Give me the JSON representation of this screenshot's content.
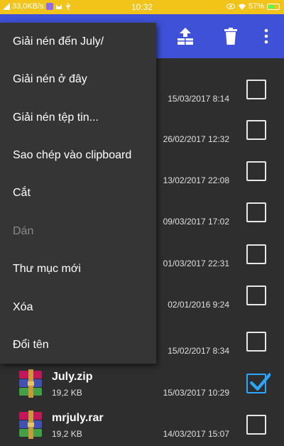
{
  "status_bar": {
    "speed": "33,0KB/s",
    "time": "10:32",
    "battery": "57%"
  },
  "menu": {
    "items": [
      {
        "label": "Giải nén đến July/",
        "enabled": true
      },
      {
        "label": "Giải nén ở đây",
        "enabled": true
      },
      {
        "label": "Giải nén tệp tin...",
        "enabled": true
      },
      {
        "label": "Sao chép vào clipboard",
        "enabled": true
      },
      {
        "label": "Cắt",
        "enabled": true
      },
      {
        "label": "Dán",
        "enabled": false
      },
      {
        "label": "Thư mục mới",
        "enabled": true
      },
      {
        "label": "Xóa",
        "enabled": true
      },
      {
        "label": "Đổi tên",
        "enabled": true
      }
    ]
  },
  "files": [
    {
      "name": "",
      "size": "",
      "date": "15/03/2017 8:14",
      "checked": false
    },
    {
      "name": "",
      "size": "",
      "date": "26/02/2017 12:32",
      "checked": false
    },
    {
      "name": "",
      "size": "",
      "date": "13/02/2017 22:08",
      "checked": false
    },
    {
      "name": "",
      "size": "",
      "date": "09/03/2017 17:02",
      "checked": false
    },
    {
      "name": "",
      "size": "",
      "date": "01/03/2017 22:31",
      "checked": false
    },
    {
      "name": "",
      "size": "",
      "date": "02/01/2016 9:24",
      "checked": false
    },
    {
      "name": "",
      "size": "",
      "date": "15/02/2017 8:34",
      "checked": false
    },
    {
      "name": "July.zip",
      "size": "19,2 KB",
      "date": "15/03/2017 10:29",
      "checked": true
    },
    {
      "name": "mrjuly.rar",
      "size": "19,2 KB",
      "date": "14/03/2017 15:07",
      "checked": false
    }
  ],
  "colors": {
    "status_bar": "#f2c318",
    "app_bar": "#3f51d7",
    "background": "#2e2e2e",
    "menu": "#353535",
    "check_accent": "#2aa6ff"
  },
  "icons": {
    "app_bar": [
      "archive-upload-icon",
      "trash-icon",
      "more-vert-icon"
    ],
    "archive_file": "winrar-archive-icon",
    "checkmark": "check-icon"
  }
}
